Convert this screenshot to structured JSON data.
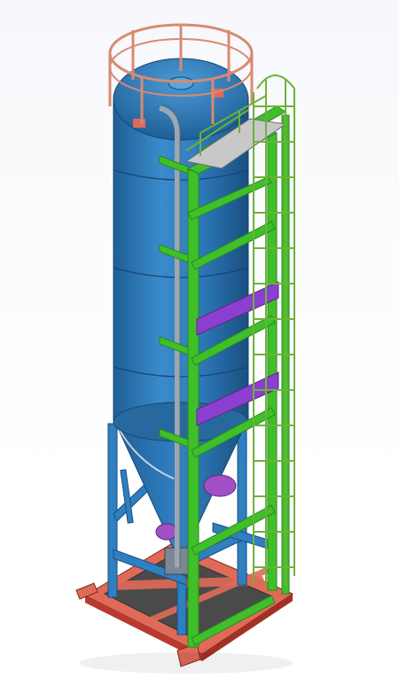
{
  "scene": {
    "subject": "silo-3d-model",
    "colors": {
      "background_top": "#f6f8fb",
      "background_bottom": "#ffffff",
      "silo_body": "#2f7fc1",
      "silo_shadow": "#1e5f96",
      "silo_highlight": "#4b9ad8",
      "frame": "#3fbf2a",
      "frame_dark": "#2a8a1d",
      "base_frame": "#e06a58",
      "base_plate": "#b83b2e",
      "purple_beam": "#8a3fd1",
      "railing": "#d98a70",
      "ladder": "#6db23a",
      "pipe": "#9aa8b4",
      "support_legs": "#2f7fc1"
    }
  }
}
